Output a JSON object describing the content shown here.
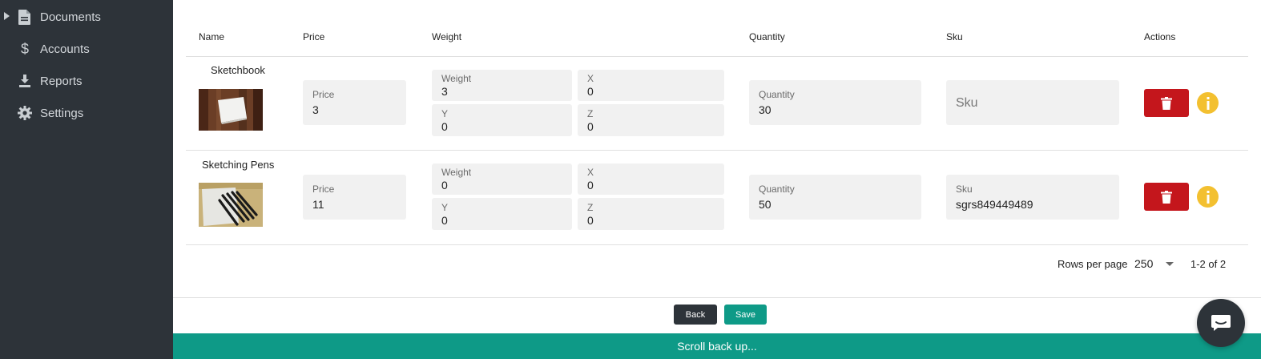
{
  "sidebar": {
    "items": [
      {
        "label": "Documents",
        "icon": "document-icon"
      },
      {
        "label": "Accounts",
        "icon": "dollar-icon"
      },
      {
        "label": "Reports",
        "icon": "download-icon"
      },
      {
        "label": "Settings",
        "icon": "gear-icon"
      }
    ]
  },
  "table": {
    "headers": {
      "name": "Name",
      "price": "Price",
      "weight": "Weight",
      "quantity": "Quantity",
      "sku": "Sku",
      "actions": "Actions"
    },
    "rows": [
      {
        "name": "Sketchbook",
        "price_label": "Price",
        "price": "3",
        "weight_label": "Weight",
        "weight": "3",
        "x_label": "X",
        "x": "0",
        "y_label": "Y",
        "y": "0",
        "z_label": "Z",
        "z": "0",
        "quantity_label": "Quantity",
        "quantity": "30",
        "sku_placeholder": "Sku",
        "sku": ""
      },
      {
        "name": "Sketching Pens",
        "price_label": "Price",
        "price": "11",
        "weight_label": "Weight",
        "weight": "0",
        "x_label": "X",
        "x": "0",
        "y_label": "Y",
        "y": "0",
        "z_label": "Z",
        "z": "0",
        "quantity_label": "Quantity",
        "quantity": "50",
        "sku_label": "Sku",
        "sku": "sgrs849449489"
      }
    ]
  },
  "pagination": {
    "rows_per_page_label": "Rows per page",
    "rows_per_page": "250",
    "range": "1-2 of 2"
  },
  "footer": {
    "back_label": "Back",
    "save_label": "Save",
    "scroll_label": "Scroll back up..."
  },
  "colors": {
    "sidebar": "#2d3339",
    "accent": "#0e9a87",
    "delete": "#c4161c",
    "info": "#f3c030"
  }
}
